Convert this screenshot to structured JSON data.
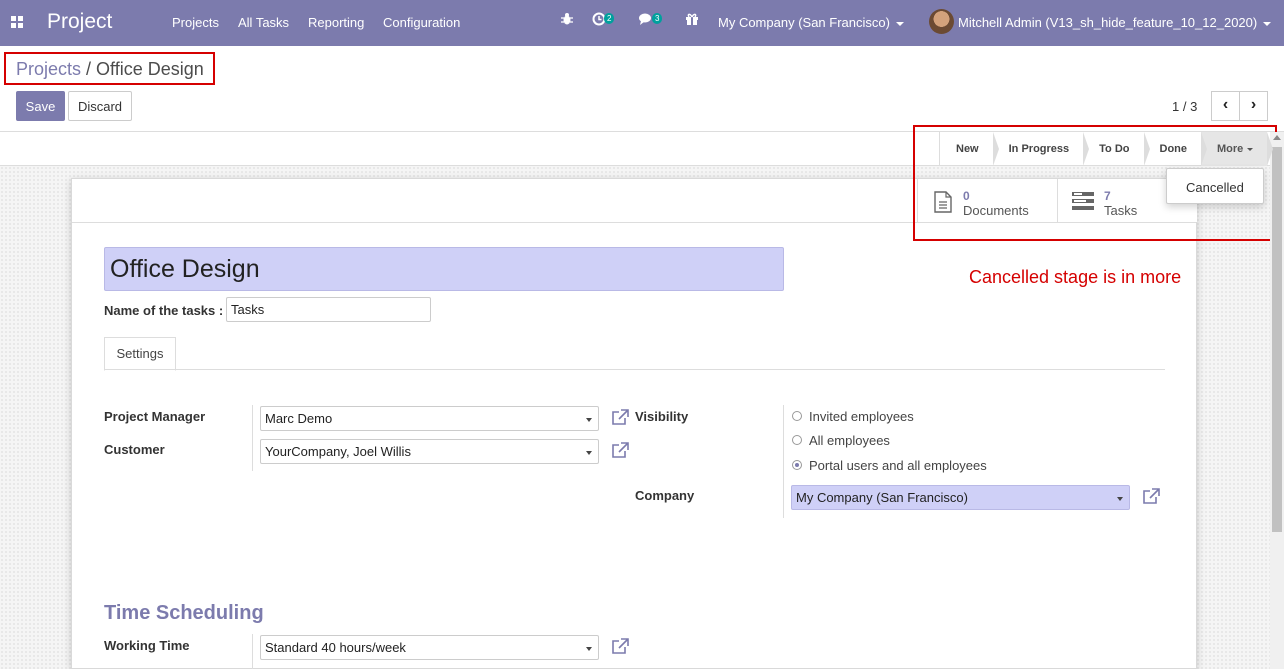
{
  "navbar": {
    "brand": "Project",
    "menu": [
      "Projects",
      "All Tasks",
      "Reporting",
      "Configuration"
    ],
    "activity_count": "2",
    "message_count": "3",
    "company": "My Company (San Francisco)",
    "user": "Mitchell Admin (V13_sh_hide_feature_10_12_2020)"
  },
  "breadcrumb": {
    "parent": "Projects",
    "separator": " / ",
    "current": "Office Design"
  },
  "buttons": {
    "save": "Save",
    "discard": "Discard"
  },
  "pager": {
    "value": "1 / 3",
    "prev": "‹",
    "next": "›"
  },
  "stages": [
    "New",
    "In Progress",
    "To Do",
    "Done"
  ],
  "more_label": "More",
  "dropdown_items": [
    "Cancelled"
  ],
  "smart_buttons": {
    "documents": {
      "count": "0",
      "label": "Documents"
    },
    "tasks": {
      "count": "7",
      "label": "Tasks"
    }
  },
  "annotation": "Cancelled stage is in more",
  "form": {
    "name": "Office Design",
    "tasks_label": "Name of the tasks :",
    "tasks_value": "Tasks",
    "tab": "Settings",
    "project_manager_label": "Project Manager",
    "project_manager": "Marc Demo",
    "customer_label": "Customer",
    "customer": "YourCompany, Joel Willis",
    "visibility_label": "Visibility",
    "visibility_options": [
      "Invited employees",
      "All employees",
      "Portal users and all employees"
    ],
    "visibility_selected": 2,
    "company_label": "Company",
    "company": "My Company (San Francisco)",
    "section_title": "Time Scheduling",
    "working_time_label": "Working Time",
    "working_time": "Standard 40 hours/week"
  },
  "colors": {
    "brand": "#7c7bad",
    "annotation": "#d50000",
    "field_highlight": "#cfd0f7"
  }
}
